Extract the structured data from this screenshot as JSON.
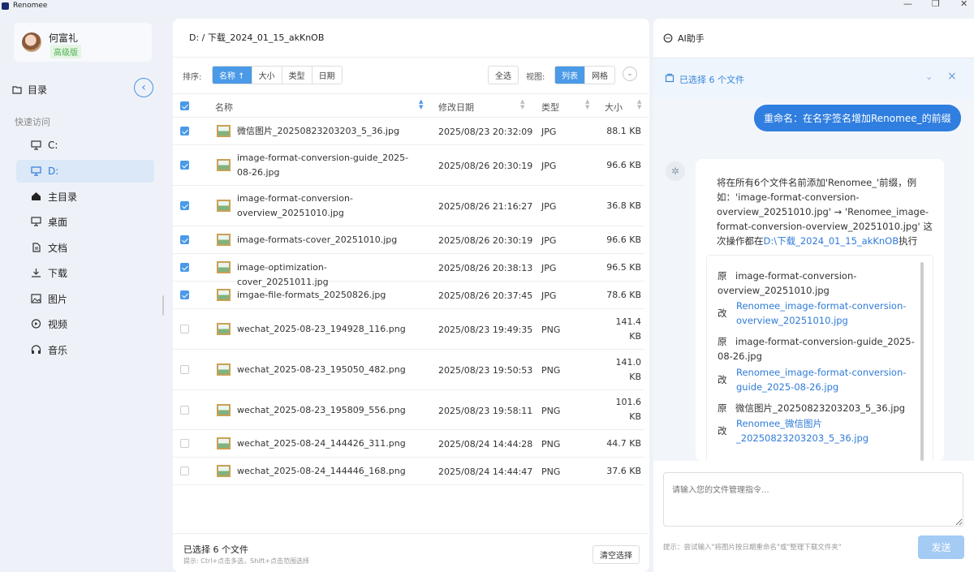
{
  "app": {
    "title": "Renomee"
  },
  "sidebar": {
    "user": {
      "name": "何富礼",
      "badge": "高级版"
    },
    "directory_label": "目录",
    "quick_access_label": "快速访问",
    "items": [
      {
        "label": "C:",
        "icon": "monitor-icon"
      },
      {
        "label": "D:",
        "icon": "monitor-icon",
        "active": true
      },
      {
        "label": "主目录",
        "icon": "home-icon"
      },
      {
        "label": "桌面",
        "icon": "monitor-icon"
      },
      {
        "label": "文档",
        "icon": "document-icon"
      },
      {
        "label": "下载",
        "icon": "download-icon"
      },
      {
        "label": "图片",
        "icon": "image-icon"
      },
      {
        "label": "视频",
        "icon": "play-icon"
      },
      {
        "label": "音乐",
        "icon": "headphones-icon"
      }
    ]
  },
  "main": {
    "path": "D: / 下载_2024_01_15_akKnOB",
    "sort_label": "排序:",
    "sort_options": [
      "名称 ↑",
      "大小",
      "类型",
      "日期"
    ],
    "select_all": "全选",
    "view_label": "视图:",
    "view_options": [
      "列表",
      "网格"
    ],
    "columns": {
      "name": "名称",
      "date": "修改日期",
      "type": "类型",
      "size": "大小"
    },
    "files": [
      {
        "name": "微信图片_20250823203203_5_36.jpg",
        "date": "2025/08/23 20:32:09",
        "type": "JPG",
        "size": "88.1 KB",
        "checked": true
      },
      {
        "name": "image-format-conversion-guide_2025-08-26.jpg",
        "date": "2025/08/26 20:30:19",
        "type": "JPG",
        "size": "96.6 KB",
        "checked": true
      },
      {
        "name": "image-format-conversion-overview_20251010.jpg",
        "date": "2025/08/26 21:16:27",
        "type": "JPG",
        "size": "36.8 KB",
        "checked": true
      },
      {
        "name": "image-formats-cover_20251010.jpg",
        "date": "2025/08/26 20:30:19",
        "type": "JPG",
        "size": "96.6 KB",
        "checked": true
      },
      {
        "name": "image-optimization-cover_20251011.jpg",
        "date": "2025/08/26 20:38:13",
        "type": "JPG",
        "size": "96.5 KB",
        "checked": true
      },
      {
        "name": "imgae-file-formats_20250826.jpg",
        "date": "2025/08/26 20:37:45",
        "type": "JPG",
        "size": "78.6 KB",
        "checked": true
      },
      {
        "name": "wechat_2025-08-23_194928_116.png",
        "date": "2025/08/23 19:49:35",
        "type": "PNG",
        "size": "141.4 KB",
        "checked": false
      },
      {
        "name": "wechat_2025-08-23_195050_482.png",
        "date": "2025/08/23 19:50:53",
        "type": "PNG",
        "size": "141.0 KB",
        "checked": false
      },
      {
        "name": "wechat_2025-08-23_195809_556.png",
        "date": "2025/08/23 19:58:11",
        "type": "PNG",
        "size": "101.6 KB",
        "checked": false
      },
      {
        "name": "wechat_2025-08-24_144426_311.png",
        "date": "2025/08/24 14:44:28",
        "type": "PNG",
        "size": "44.7 KB",
        "checked": false
      },
      {
        "name": "wechat_2025-08-24_144446_168.png",
        "date": "2025/08/24 14:44:47",
        "type": "PNG",
        "size": "37.6 KB",
        "checked": false
      }
    ],
    "footer": {
      "selected": "已选择 6 个文件",
      "hint": "提示: Ctrl+点击多选，Shift+点击范围选择",
      "clear": "清空选择"
    }
  },
  "ai": {
    "title": "AI助手",
    "selection": "已选择 6 个文件",
    "user_message": "重命名：在名字签名增加Renomee_的前缀",
    "reply": {
      "text_before": "将在所有6个文件名前添加'Renomee_'前缀，例如：'image-format-conversion-overview_20251010.jpg' → 'Renomee_image-format-conversion-overview_20251010.jpg' 这次操作都在",
      "link": "D:\\下载_2024_01_15_akKnOB",
      "text_after": "执行"
    },
    "orig_label": "原",
    "new_label": "改",
    "changes": [
      {
        "from": "image-format-conversion-overview_20251010.jpg",
        "to": "Renomee_image-format-conversion-overview_20251010.jpg"
      },
      {
        "from": "image-format-conversion-guide_2025-08-26.jpg",
        "to": "Renomee_image-format-conversion-guide_2025-08-26.jpg"
      },
      {
        "from": "微信图片_20250823203203_5_36.jpg",
        "to": "Renomee_微信图片_20250823203203_5_36.jpg"
      }
    ],
    "input_placeholder": "请输入您的文件管理指令...",
    "hint": "提示：尝试输入\"将图片按日期重命名\"或\"整理下载文件夹\"",
    "send": "发送"
  }
}
